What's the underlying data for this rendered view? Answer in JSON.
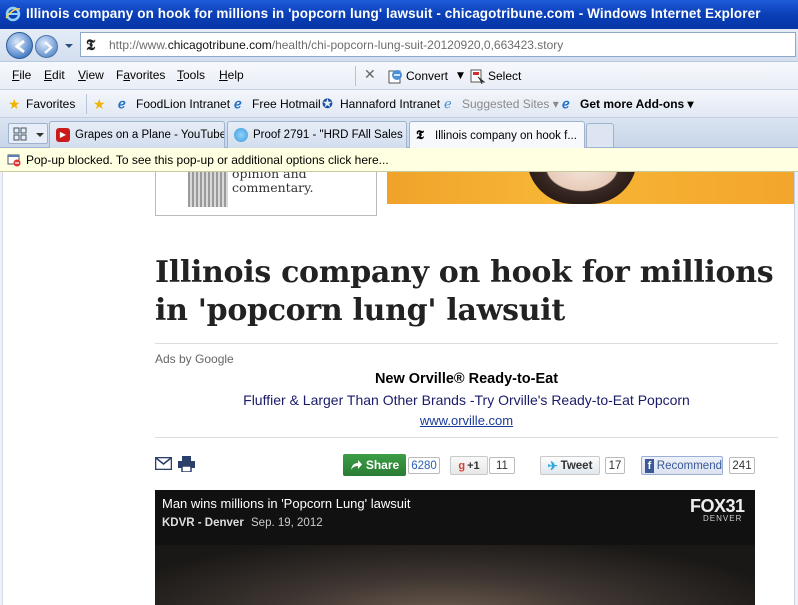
{
  "window": {
    "title": "Illinois company on hook for millions in 'popcorn lung' lawsuit - chicagotribune.com - Windows Internet Explorer"
  },
  "address": {
    "url_prefix": "http://www.",
    "url_domain": "chicagotribune.com",
    "url_path": "/health/chi-popcorn-lung-suit-20120920,0,663423.story"
  },
  "menu": {
    "items": [
      {
        "label": "File",
        "underline": "F"
      },
      {
        "label": "Edit",
        "underline": "E"
      },
      {
        "label": "View",
        "underline": "V"
      },
      {
        "label": "Favorites",
        "underline": "a"
      },
      {
        "label": "Tools",
        "underline": "T"
      },
      {
        "label": "Help",
        "underline": "H"
      }
    ],
    "convert_label": "Convert",
    "select_label": "Select"
  },
  "favorites_bar": {
    "favorites_label": "Favorites",
    "items": [
      {
        "label": "FoodLion Intranet",
        "muted": false,
        "bold": false
      },
      {
        "label": "Free Hotmail",
        "muted": false,
        "bold": false
      },
      {
        "label": "Hannaford Intranet",
        "muted": false,
        "bold": false
      },
      {
        "label": "Suggested Sites ▾",
        "muted": true,
        "bold": false
      },
      {
        "label": "Get more Add-ons ▾",
        "muted": false,
        "bold": true
      }
    ]
  },
  "tabs": [
    {
      "label": "Grapes on a Plane - YouTube",
      "active": false
    },
    {
      "label": "Proof 2791 - \"HRD FAll Sales ...",
      "active": false
    },
    {
      "label": "Illinois company on hook f...",
      "active": true
    }
  ],
  "infobar": {
    "text": "Pop-up blocked. To see this pop-up or additional options click here..."
  },
  "page": {
    "sidebar_ad_text": "opinion and commentary.",
    "headline": "Illinois company on hook for millions in 'popcorn lung' lawsuit",
    "ads_by": "Ads by Google",
    "ad": {
      "title": "New Orville® Ready-to-Eat",
      "description": "Fluffier & Larger Than Other Brands -Try Orville's Ready-to-Eat Popcorn",
      "url": "www.orville.com"
    },
    "social": {
      "share_label": "Share",
      "share_count": "6280",
      "gplus_label": "+1",
      "gplus_count": "11",
      "tweet_label": "Tweet",
      "tweet_count": "17",
      "recommend_label": "Recommend",
      "recommend_count": "241"
    },
    "video": {
      "title": "Man wins millions in 'Popcorn Lung' lawsuit",
      "source": "KDVR - Denver",
      "date": "Sep. 19, 2012",
      "logo": "FOX31",
      "logo_sub": "DENVER"
    }
  }
}
